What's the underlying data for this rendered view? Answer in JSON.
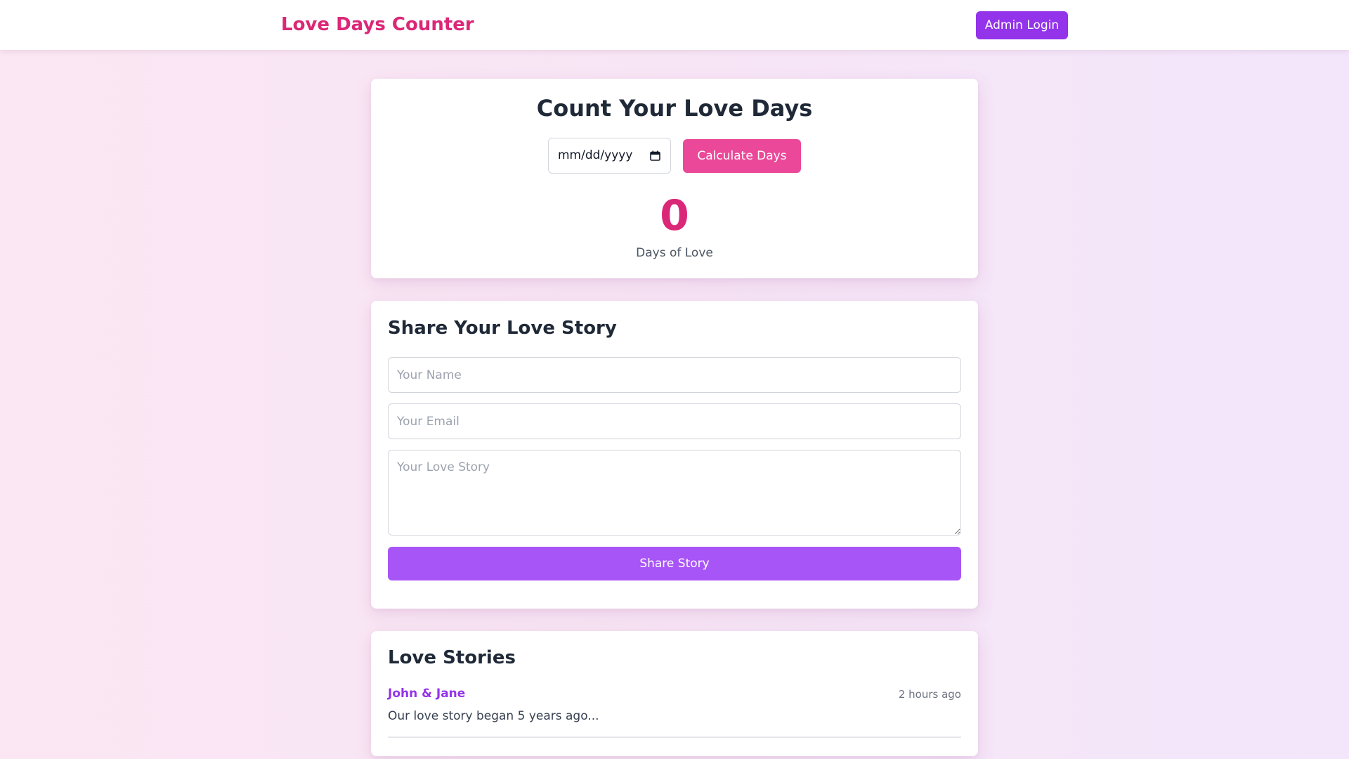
{
  "header": {
    "brand": "Love Days Counter",
    "admin_login_label": "Admin Login"
  },
  "counter": {
    "title": "Count Your Love Days",
    "date_placeholder": "mm/dd/yyyy",
    "calculate_label": "Calculate Days",
    "days_value": "0",
    "days_label": "Days of Love"
  },
  "share": {
    "title": "Share Your Love Story",
    "name_placeholder": "Your Name",
    "email_placeholder": "Your Email",
    "story_placeholder": "Your Love Story",
    "submit_label": "Share Story"
  },
  "stories": {
    "title": "Love Stories",
    "items": [
      {
        "author": "John & Jane",
        "time": "2 hours ago",
        "text": "Our love story began 5 years ago..."
      }
    ]
  },
  "colors": {
    "brand": "#db2777",
    "admin_button": "#9333ea",
    "calculate_button": "#ec4899",
    "share_button": "#a855f7",
    "author": "#9333ea"
  },
  "icons": {
    "date_picker": "calendar-icon"
  }
}
